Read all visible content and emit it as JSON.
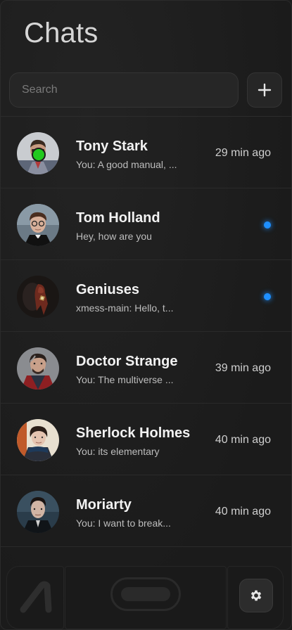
{
  "header": {
    "title": "Chats"
  },
  "search": {
    "placeholder": "Search",
    "value": ""
  },
  "chats": [
    {
      "name": "Tony Stark",
      "preview": "You: A good manual, ...",
      "time": "29 min ago",
      "online": true,
      "unread": false
    },
    {
      "name": "Tom Holland",
      "preview": "Hey, how are you",
      "time": "",
      "online": false,
      "unread": true
    },
    {
      "name": "Geniuses",
      "preview": "xmess-main: Hello, t...",
      "time": "",
      "online": false,
      "unread": true
    },
    {
      "name": "Doctor Strange",
      "preview": "You: The multiverse ...",
      "time": "39 min ago",
      "online": false,
      "unread": false
    },
    {
      "name": "Sherlock Holmes",
      "preview": "You: its elementary",
      "time": "40 min ago",
      "online": false,
      "unread": false
    },
    {
      "name": "Moriarty",
      "preview": "You: I want to break...",
      "time": "40 min ago",
      "online": false,
      "unread": false
    }
  ],
  "icons": {
    "add": "plus-icon",
    "settings": "gear-icon",
    "logo": "slash-logo-icon"
  },
  "colors": {
    "online": "#22c91e",
    "unread": "#1e8fff",
    "background": "#1c1c1c"
  }
}
